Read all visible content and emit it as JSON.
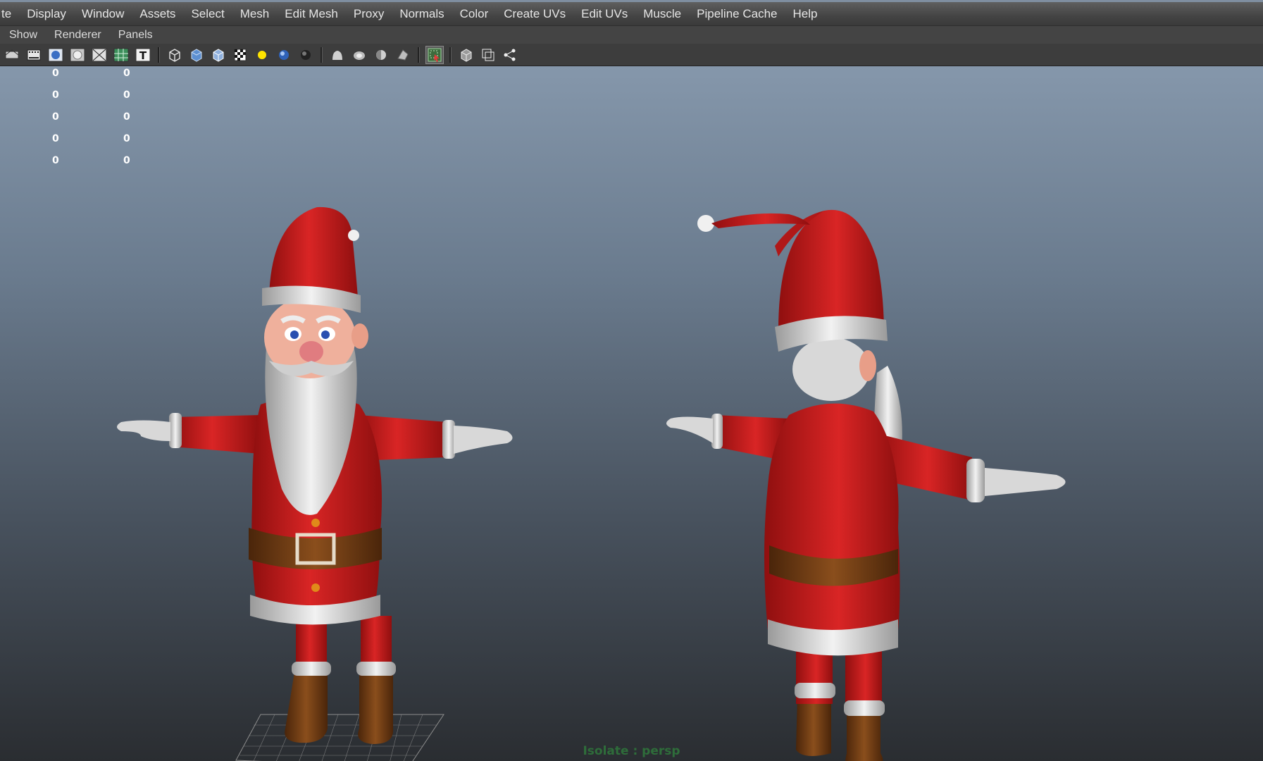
{
  "menubar": {
    "items": [
      "te",
      "Display",
      "Window",
      "Assets",
      "Select",
      "Mesh",
      "Edit Mesh",
      "Proxy",
      "Normals",
      "Color",
      "Create UVs",
      "Edit UVs",
      "Muscle",
      "Pipeline Cache",
      "Help"
    ]
  },
  "panel_menu": {
    "items": [
      "Show",
      "Renderer",
      "Panels"
    ]
  },
  "toolbar": {
    "groups": [
      [
        "layers-icon",
        "film-gate-icon",
        "sphere-icon",
        "resolution-gate-icon",
        "safe-area-icon",
        "grid-icon",
        "text-icon"
      ],
      [
        "wireframe-cube-icon",
        "smooth-shaded-cube-icon",
        "shaded-wireframe-cube-icon",
        "textured-icon",
        "default-light-icon",
        "all-lights-icon",
        "shadows-icon"
      ],
      [
        "ambient-occlusion-icon",
        "motion-blur-icon",
        "antialiasing-icon",
        "depth-of-field-icon"
      ],
      [
        "isolate-select-icon"
      ],
      [
        "xray-icon",
        "xray-joints-icon",
        "xray-active-components-icon"
      ]
    ],
    "active_icon": "isolate-select-icon"
  },
  "hud": {
    "rows": [
      {
        "a": "0",
        "b": "0"
      },
      {
        "a": "0",
        "b": "0"
      },
      {
        "a": "0",
        "b": "0"
      },
      {
        "a": "0",
        "b": "0"
      },
      {
        "a": "0",
        "b": "0"
      }
    ]
  },
  "viewport": {
    "isolate_label": "Isolate : persp",
    "models": [
      "santa-front-view",
      "santa-back-view"
    ]
  },
  "colors": {
    "menu_text": "#e6e6e6",
    "suit_red": "#c21a1a",
    "fur_white": "#e8e8e8",
    "belt_brown": "#6b3a12",
    "isolate_green": "#2e6d3a"
  }
}
